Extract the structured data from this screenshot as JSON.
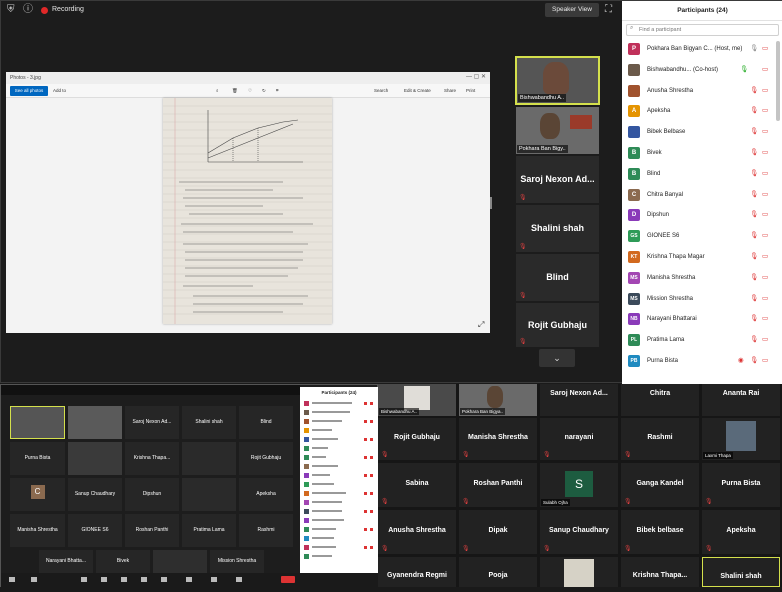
{
  "top": {
    "recording_label": "Recording",
    "speaker_view_label": "Speaker View",
    "photos": {
      "title": "Photos - 3.jpg",
      "see_all_label": "See all photos",
      "add_label": "Add to",
      "search_label": "Search",
      "edit_label": "Edit & Create",
      "share_label": "Share",
      "print_label": "Print"
    },
    "video_tiles": [
      {
        "name": "Bishwabandhu A..",
        "type": "video"
      },
      {
        "name": "Pokhara Ban Bigy..",
        "type": "video"
      },
      {
        "name": "Saroj Nexon Ad...",
        "type": "name"
      },
      {
        "name": "Shalini shah",
        "type": "name"
      },
      {
        "name": "Blind",
        "type": "name"
      },
      {
        "name": "Rojit Gubhaju",
        "type": "name"
      }
    ]
  },
  "panel": {
    "title": "Participants (24)",
    "search_placeholder": "Find a participant",
    "participants": [
      {
        "initial": "P",
        "name": "Pokhara Ban Bigyan C... (Host, me)",
        "color": "#c0305a"
      },
      {
        "initial": "",
        "name": "Bishwabandhu... (Co-host)",
        "color": "#6b5a4a"
      },
      {
        "initial": "",
        "name": "Anusha Shrestha",
        "color": "#a0522d"
      },
      {
        "initial": "A",
        "name": "Apeksha",
        "color": "#e59400"
      },
      {
        "initial": "",
        "name": "Bibek Belbase",
        "color": "#3456a0"
      },
      {
        "initial": "B",
        "name": "Bivek",
        "color": "#2e8b57"
      },
      {
        "initial": "B",
        "name": "Blind",
        "color": "#2e8b57"
      },
      {
        "initial": "C",
        "name": "Chitra Banyal",
        "color": "#8b6a4f"
      },
      {
        "initial": "D",
        "name": "Dipshun",
        "color": "#8a3ab9"
      },
      {
        "initial": "GS",
        "name": "GIONEE S6",
        "color": "#2e9b57"
      },
      {
        "initial": "KT",
        "name": "Krishna Thapa Magar",
        "color": "#d2691e"
      },
      {
        "initial": "MS",
        "name": "Manisha Shrestha",
        "color": "#a346b3"
      },
      {
        "initial": "MS",
        "name": "Mission Shrestha",
        "color": "#3b4a5a"
      },
      {
        "initial": "NB",
        "name": "Narayani Bhattarai",
        "color": "#8a3ab9"
      },
      {
        "initial": "PL",
        "name": "Pratima Lama",
        "color": "#2e8b57"
      },
      {
        "initial": "PB",
        "name": "Purna Bista",
        "color": "#1f8ac0"
      }
    ]
  },
  "bottom_left": {
    "tiles": [
      "Saroj Nexon Ad...",
      "Shalini shah",
      "Blind",
      "Purna Bista",
      "Krishna Thapa...",
      "Rojit Gubhaju",
      "Sanup Chaudhary",
      "Dipshun",
      "Apeksha",
      "Manisha Shrestha",
      "GIONEE S6",
      "Roshan Panthi",
      "Pratima Lama",
      "Rashmi",
      "Narayani Bhatta...",
      "Bivek",
      "Mission Shrestha"
    ],
    "panel_title": "Participants (24)"
  },
  "gallery": {
    "row1": [
      "Saroj Nexon Ad...",
      "Chitra",
      "Ananta Rai"
    ],
    "row2": [
      "Rojit Gubhaju",
      "Manisha Shrestha",
      "narayani",
      "Rashmi",
      "Laxmi Thapa"
    ],
    "row3": [
      "Sabina",
      "Roshan Panthi",
      "Sulabh Ojha",
      "Ganga Kandel",
      "Purna Bista"
    ],
    "row4": [
      "Anusha Shrestha",
      "Dipak",
      "Sanup Chaudhary",
      "Bibek belbase",
      "Apeksha"
    ],
    "row5": [
      "Gyanendra Regmi",
      "Pooja",
      "",
      "Krishna  Thapa...",
      "Shalini shah"
    ],
    "top_labels": [
      "Bishwabandhu A..",
      "Pokhara Ban Bigya.."
    ],
    "s_initial": "S"
  }
}
